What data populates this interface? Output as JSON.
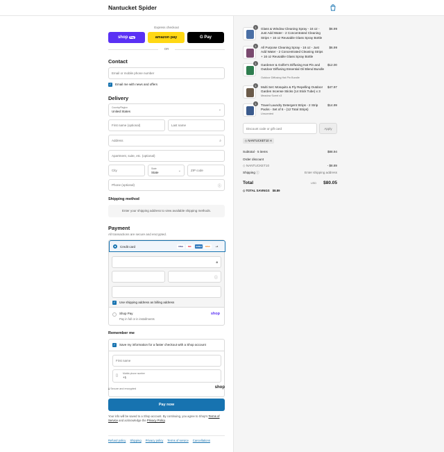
{
  "store": {
    "name": "Nantucket Spider"
  },
  "express": {
    "label": "Express checkout",
    "buttons": [
      "shop",
      "Pay",
      "amazon pay",
      "G Pay"
    ],
    "or": "OR"
  },
  "contact": {
    "heading": "Contact",
    "email_placeholder": "Email or mobile phone number",
    "news_label": "Email me with news and offers"
  },
  "delivery": {
    "heading": "Delivery",
    "country_label": "Country/Region",
    "country_value": "United States",
    "first_name": "First name (optional)",
    "last_name": "Last name",
    "address": "Address",
    "apartment": "Apartment, suite, etc. (optional)",
    "city": "City",
    "state_label": "State",
    "state_value": "State",
    "zip": "ZIP code",
    "phone": "Phone (optional)"
  },
  "shipping": {
    "heading": "Shipping method",
    "message": "Enter your shipping address to view available shipping methods."
  },
  "payment": {
    "heading": "Payment",
    "secure_note": "All transactions are secure and encrypted.",
    "credit_card_label": "Credit card",
    "card_brands": [
      "VISA",
      "MC",
      "AMEX",
      "DISC",
      "+4"
    ],
    "billing_label": "Use shipping address as billing address",
    "shop_pay_label": "Shop Pay",
    "shop_pay_sub": "Pay in full or in installments",
    "shop_pay_logo": "shop"
  },
  "remember": {
    "heading": "Remember me",
    "save_label": "Save my information for a faster checkout with a Shop account",
    "first_name": "First name",
    "phone_label": "Mobile phone number",
    "phone_value": "+1",
    "secure": "Secure and encrypted",
    "shop_logo": "shop"
  },
  "pay_now": "Pay now",
  "legal": {
    "prefix": "Your info will be saved to a Shop account. By continuing, you agree to Shop's",
    "tos": "Terms of Service",
    "middle": "and acknowledge the",
    "privacy": "Privacy Policy",
    "suffix": "."
  },
  "footer_links": [
    "Refund policy",
    "Shipping",
    "Privacy policy",
    "Terms of service",
    "Cancellations"
  ],
  "cart": {
    "items": [
      {
        "qty": "1",
        "title": "Glass & Window Cleaning Spray - 16 oz - Just Add Water - 2 Concentrated Cleaning Strips + 16 oz Reusable Glass Spray Bottle",
        "sub": "",
        "price": "$6.99",
        "color": "#4a6fa5"
      },
      {
        "qty": "1",
        "title": "All Purpose Cleaning Spray - 16 oz - Just Add Water - 2 Concentrated Cleaning Strips + 16 oz Reusable Glass Spray Bottle",
        "sub": "",
        "price": "$6.99",
        "color": "#7a4a6f"
      },
      {
        "qty": "1",
        "title": "Gardener & Golfer's Diffusing Hat Pin and Outdoor Diffusing Essential Oil Blend Bundle",
        "sub": "Outdoor Diffusing Hat Pin Bundle",
        "price": "$12.00",
        "color": "#2e7d4f"
      },
      {
        "qty": "1",
        "title": "Multi Set: Mosquito & Fly Repelling Outdoor Garden Incense Sticks (14 Stick Tube) x 3",
        "sub": "Meadow Scent x3",
        "price": "$47.97",
        "color": "#6b5b4a"
      },
      {
        "qty": "1",
        "title": "Travel Laundry Detergent Strips - 2 Strip Packs - Set of 6 - (12 Total Strips)",
        "sub": "Unscented",
        "price": "$14.99",
        "color": "#3a5a8c"
      }
    ],
    "discount_placeholder": "Discount code or gift card",
    "apply": "Apply",
    "applied_code": "NANTUCKET10",
    "subtotal_label": "Subtotal · 5 items",
    "subtotal_value": "$88.94",
    "order_discount_label": "Order discount",
    "discount_code": "NANTUCKET10",
    "discount_value": "- $8.89",
    "shipping_label": "Shipping",
    "shipping_value": "Enter shipping address",
    "total_label": "Total",
    "currency": "USD",
    "total_value": "$80.05",
    "savings_label": "TOTAL SAVINGS",
    "savings_value": "$8.89"
  }
}
